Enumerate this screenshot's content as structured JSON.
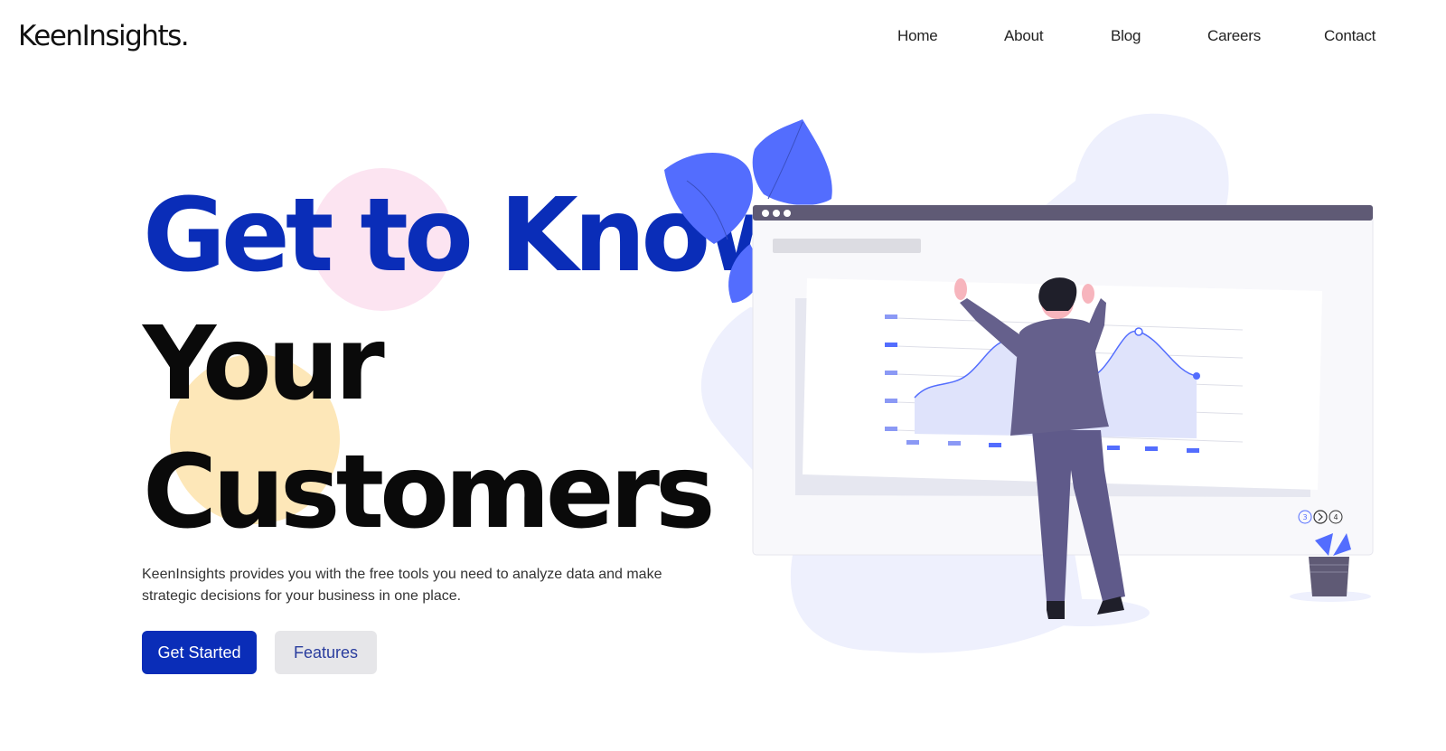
{
  "brand": {
    "logo_text": "KeenInsights."
  },
  "nav": {
    "items": [
      {
        "label": "Home"
      },
      {
        "label": "About"
      },
      {
        "label": "Blog"
      },
      {
        "label": "Careers"
      },
      {
        "label": "Contact"
      }
    ]
  },
  "hero": {
    "headline_line1": "Get to Know",
    "headline_line2": "Your",
    "headline_line3": "Customers",
    "description": "KeenInsights provides you with the free tools you need to analyze data and make strategic decisions for your business in one place.",
    "primary_button": "Get Started",
    "secondary_button": "Features"
  },
  "illustration": {
    "pager": [
      "3",
      "4"
    ]
  },
  "colors": {
    "accent": "#0a2db8",
    "illustration_blue": "#536dfe",
    "pink_circle": "#fce4f1",
    "yellow_circle": "#fde7b8"
  }
}
